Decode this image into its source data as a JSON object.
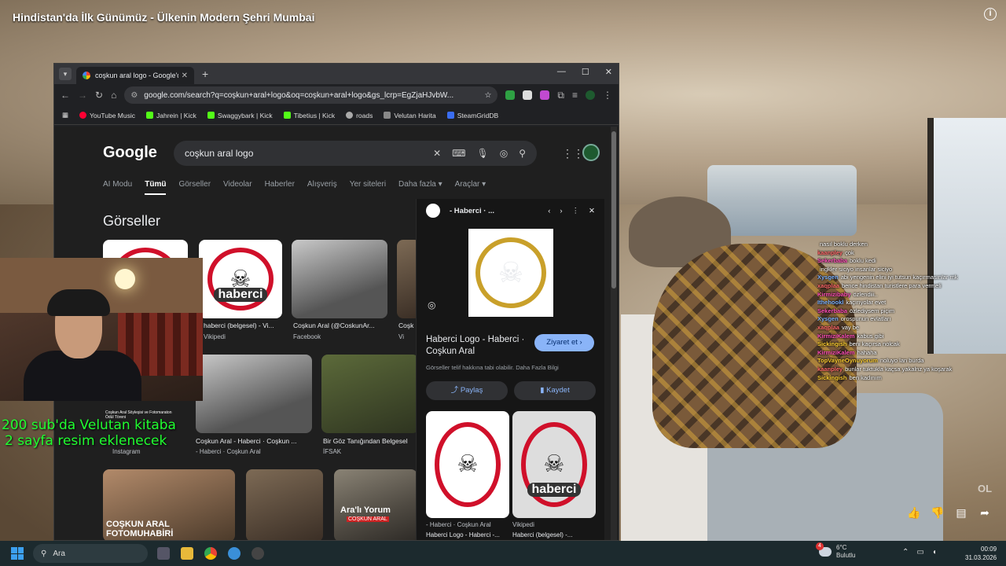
{
  "stream": {
    "title": "Hindistan'da İlk Günümüz - Ülkenin Modern Şehri Mumbai",
    "overlay_line1": "200 sub'da Velutan kitaba",
    "overlay_line2": "2 sayfa resim eklenecek",
    "watermark": "OL"
  },
  "browser": {
    "tab_title": "coşkun aral logo - Google'da A",
    "url": "google.com/search?q=coşkun+aral+logo&oq=coşkun+aral+logo&gs_lcrp=EgZjaHJvbW...",
    "bookmarks": [
      {
        "label": "YouTube Music",
        "color": "#ff0033"
      },
      {
        "label": "Jahrein | Kick",
        "color": "#53fc18"
      },
      {
        "label": "Swaggybark | Kick",
        "color": "#53fc18"
      },
      {
        "label": "Tibetius | Kick",
        "color": "#53fc18"
      },
      {
        "label": "roads",
        "color": "#aaaaaa"
      },
      {
        "label": "Velutan Harita",
        "color": "#888888"
      },
      {
        "label": "SteamGridDB",
        "color": "#3a6df0"
      }
    ]
  },
  "google": {
    "logo": "Google",
    "query": "coşkun aral logo",
    "tabs": [
      "AI Modu",
      "Tümü",
      "Görseller",
      "Videolar",
      "Haberler",
      "Alışveriş",
      "Yer siteleri",
      "Daha fazla ▾",
      "Araçlar ▾"
    ],
    "active_tab": "Tümü",
    "section_title": "Görseller",
    "results": [
      {
        "caption": "haberci (belgesel) - Vi...",
        "source": "Vikipedi"
      },
      {
        "caption": "Coşkun Aral (@CoskunAr...",
        "source": "Facebook"
      },
      {
        "caption": "Coşk",
        "source": "Vi"
      },
      {
        "caption": "Coşkun Aral - Haberci · Coşkun ...",
        "source": "- Haberci · Coşkun Aral"
      },
      {
        "caption": "Bir Göz Tanığından Belgesel",
        "source": "İFSAK"
      },
      {
        "caption": "",
        "source": "Instagram"
      }
    ],
    "photo_texts": {
      "fotomuhabiri": "COŞKUN ARAL\nFOTOMUHABİRİ",
      "arali": "Ara'lı Yorum",
      "arali_sub": "COŞKUN ARAL",
      "insta_caption": "Coşkun Aral Söyleşisi ve Fotomaraton Ödül Töreni"
    }
  },
  "panel": {
    "head_title": "- Haberci · ...",
    "title": "Haberci Logo - Haberci · Coşkun Aral",
    "visit_label": "Ziyaret et",
    "note": "Görseller telif hakkına tabi olabilir. Daha Fazla Bilgi",
    "share_label": "Paylaş",
    "save_label": "Kaydet",
    "related": [
      {
        "source": "- Haberci · Coşkun Aral",
        "caption": "Haberci Logo - Haberci -..."
      },
      {
        "source": "Vikipedi",
        "caption": "Haberci (belgesel) -..."
      }
    ],
    "logo_word": "haberci"
  },
  "chat": [
    {
      "user": "",
      "color": "#ffffff",
      "text": "nasıl boklu derken"
    },
    {
      "user": "kaanpley",
      "color": "#ff6a6a",
      "text": "çok"
    },
    {
      "user": "Sekerbaba",
      "color": "#ff4fb8",
      "text": "boklu kedi"
    },
    {
      "user": "",
      "color": "#ffffff",
      "text": "ingkler siciyo insanlar siciyo"
    },
    {
      "user": "Xysgen",
      "color": "#7fb3ff",
      "text": "abi yengenin elini iyi tutsun kaçırmasınlar mk"
    },
    {
      "user": "xaqplaa",
      "color": "#ff6a6a",
      "text": "bence hindistan turistlere para vermeli"
    },
    {
      "user": "Kirmizibaby",
      "color": "#ff4fb8",
      "text": "özlendiii.."
    },
    {
      "user": "Ithehookl",
      "color": "#7fb3ff",
      "text": "kaçırıyolar evet"
    },
    {
      "user": "Sekerbaba",
      "color": "#ff4fb8",
      "text": "özlediysem piçim"
    },
    {
      "user": "Xysgen",
      "color": "#7fb3ff",
      "text": "orospunun evlatları"
    },
    {
      "user": "xaqplaa",
      "color": "#ff6a6a",
      "text": "vay be"
    },
    {
      "user": "KirmiziKalem",
      "color": "#ff4fb8",
      "text": "kabus gibi"
    },
    {
      "user": "Sickingish",
      "color": "#ffcf33",
      "text": "beni kaçırsa nolcak"
    },
    {
      "user": "KirmiziKalem",
      "color": "#ff4fb8",
      "text": "hahaha"
    },
    {
      "user": "TopVayneOynuyorum",
      "color": "#ffcf33",
      "text": "noluyo lan burda"
    },
    {
      "user": "kaanpley",
      "color": "#ff6a6a",
      "text": "bunlar tuktukla kaçsa yakalnz ya koşarak"
    },
    {
      "user": "Sickingish",
      "color": "#ffcf33",
      "text": "ben kadınım"
    }
  ],
  "taskbar": {
    "search_placeholder": "Ara",
    "temperature": "6°C",
    "weather_text": "Bulutlu",
    "weather_badge": "4",
    "time": "00:09",
    "date": "31.03.2026"
  }
}
